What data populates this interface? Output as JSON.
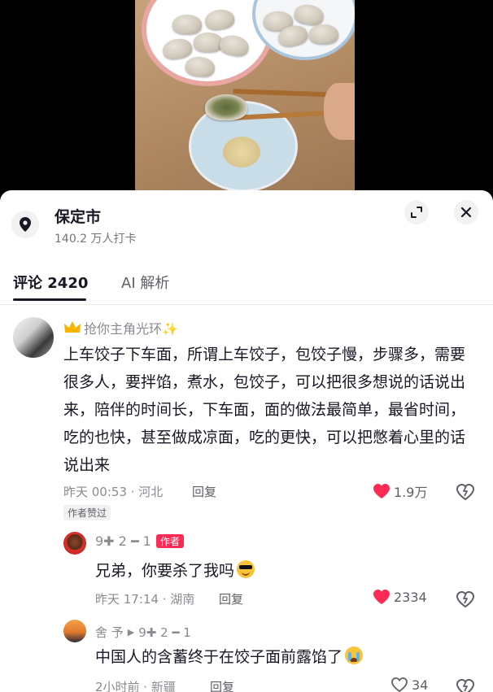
{
  "location": {
    "name": "保定市",
    "checkins": "140.2 万人打卡"
  },
  "tabs": [
    {
      "label": "评论 2420",
      "active": true
    },
    {
      "label": "AI 解析",
      "active": false
    }
  ],
  "comments": [
    {
      "user": "抢你主角光环✨",
      "text": "上车饺子下车面，所谓上车饺子，包饺子慢，步骤多，需要很多人，要拌馅，煮水，包饺子，可以把很多想说的话说出来，陪伴的时间长，下车面，面的做法最简单，最省时间，吃的也快，甚至做成凉面，吃的更快，可以把憋着心里的话说出来",
      "time_location": "昨天 00:53 · 河北",
      "reply_label": "回复",
      "likes": "1.9万",
      "liked": true,
      "author_liked": "作者赞过"
    },
    {
      "user": "9✚ 2 ━ 1",
      "author_badge": "作者",
      "text": "兄弟，你要杀了我吗",
      "emoji": "cool-face",
      "time_location": "昨天 17:14 · 湖南",
      "reply_label": "回复",
      "likes": "2334",
      "liked": true
    },
    {
      "user": "舍 予",
      "reply_to": "9✚ 2 ━ 1",
      "text": "中国人的含蓄终于在饺子面前露馅了",
      "emoji": "crying-face",
      "time_location": "2小时前 · 新疆",
      "reply_label": "回复",
      "likes": "34",
      "liked": false
    }
  ],
  "colors": {
    "like_red": "#fe2c55",
    "text_primary": "#161823",
    "text_secondary": "#8a8b91"
  }
}
